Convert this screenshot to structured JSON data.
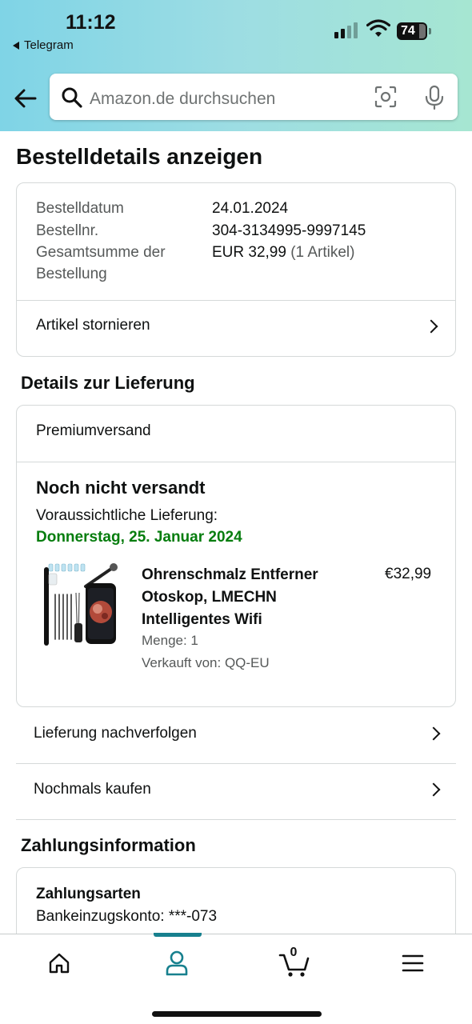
{
  "status_bar": {
    "time": "11:12",
    "back_app": "Telegram",
    "battery": "74"
  },
  "search": {
    "placeholder": "Amazon.de durchsuchen"
  },
  "page": {
    "title": "Bestelldetails anzeigen"
  },
  "order_summary": {
    "date_label": "Bestelldatum",
    "date_value": "24.01.2024",
    "number_label": "Bestellnr.",
    "number_value": "304-3134995-9997145",
    "total_label_line1": "Gesamtsumme der",
    "total_label_line2": "Bestellung",
    "total_value": "EUR 32,99",
    "total_items": "(1 Artikel)",
    "cancel_label": "Artikel stornieren"
  },
  "delivery": {
    "section_title": "Details zur Lieferung",
    "shipping_type": "Premiumversand",
    "status": "Noch nicht versandt",
    "expected_label": "Voraussichtliche Lieferung:",
    "expected_date": "Donnerstag, 25. Januar 2024",
    "product": {
      "name_line1": "Ohrenschmalz Entferner",
      "name_line2": "Otoskop, LMECHN",
      "name_line3": "Intelligentes Wifi",
      "price": "€32,99",
      "quantity": "Menge: 1",
      "seller": "Verkauft von: QQ-EU"
    }
  },
  "actions": {
    "track": "Lieferung nachverfolgen",
    "buy_again": "Nochmals kaufen"
  },
  "payment": {
    "section_title": "Zahlungsinformation",
    "methods_title": "Zahlungsarten",
    "method_value": "Bankeinzugskonto: ***-073"
  },
  "bottom_nav": {
    "cart_count": "0",
    "accent": "#17808e"
  },
  "colors": {
    "green": "#067d0e",
    "accent": "#17808e"
  }
}
